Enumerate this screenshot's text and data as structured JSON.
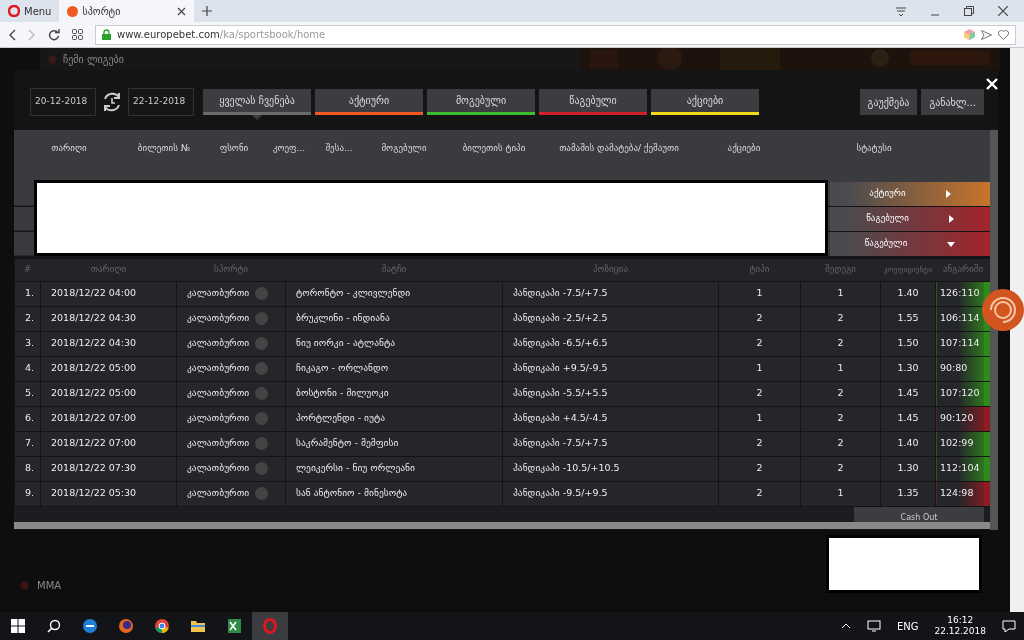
{
  "browser": {
    "menu_label": "Menu",
    "tabs": [
      {
        "label": "სპორტი",
        "selected": true
      }
    ],
    "url": {
      "domain": "www.europebet.com",
      "path": "/ka/sportsbook/home"
    }
  },
  "background": {
    "my_leagues": "ჩემი ლიგები",
    "sidebar": [
      "MMA"
    ],
    "cashout": "Cash Out"
  },
  "modal": {
    "date_from": "20-12-2018",
    "date_to": "22-12-2018",
    "filters": [
      {
        "label": "ყველას ჩვენება",
        "color": "#6b6c70",
        "selected": true
      },
      {
        "label": "აქტიური",
        "color": "#f05a22",
        "selected": false
      },
      {
        "label": "მოგებული",
        "color": "#3dbb2c",
        "selected": false
      },
      {
        "label": "წაგებული",
        "color": "#d0202a",
        "selected": false
      },
      {
        "label": "აქციები",
        "color": "#f2dc14",
        "selected": false
      }
    ],
    "actions": [
      "გაუქმება",
      "განახლ..."
    ],
    "columns": [
      "თარიღი",
      "ბილეთის №",
      "ფსონი",
      "კოეფ...",
      "შესა...",
      "მოგებული",
      "ბილეთის ტიპი",
      "თამაშის დამატება/ ქეშაუთი",
      "აქციები",
      "სტატუსი"
    ],
    "groups": [
      {
        "status": "აქტიური",
        "color": "#c8742c",
        "expanded": false
      },
      {
        "status": "წაგებული",
        "color": "#a3242c",
        "expanded": false
      },
      {
        "status": "წაგებული",
        "color": "#a3242c",
        "expanded": true
      }
    ],
    "table": {
      "columns": [
        "#",
        "თარიღი",
        "სპორტი",
        "მატჩი",
        "პოზიცია",
        "ტიპი",
        "შედეგი",
        "კოეფიციენტი",
        "ანგარიში"
      ],
      "rows": [
        {
          "num": "1.",
          "date": "2018/12/22 04:00",
          "sport": "კალათბურთი",
          "match": "ტორონტო - კლივლენდი",
          "position": "ჰანდიკაპი -7.5/+7.5",
          "type": "1",
          "result": "1",
          "coef": "1.40",
          "score": "126:110",
          "color": "#2f8a1c"
        },
        {
          "num": "2.",
          "date": "2018/12/22 04:30",
          "sport": "კალათბურთი",
          "match": "ბრუკლინი - ინდიანა",
          "position": "ჰანდიკაპი -2.5/+2.5",
          "type": "2",
          "result": "2",
          "coef": "1.55",
          "score": "106:114",
          "color": "#2f8a1c"
        },
        {
          "num": "3.",
          "date": "2018/12/22 04:30",
          "sport": "კალათბურთი",
          "match": "ნიუ იორკი - ატლანტა",
          "position": "ჰანდიკაპი -6.5/+6.5",
          "type": "2",
          "result": "2",
          "coef": "1.50",
          "score": "107:114",
          "color": "#2f8a1c"
        },
        {
          "num": "4.",
          "date": "2018/12/22 05:00",
          "sport": "კალათბურთი",
          "match": "ჩიკაგო - ორლანდო",
          "position": "ჰანდიკაპი +9.5/-9.5",
          "type": "1",
          "result": "1",
          "coef": "1.30",
          "score": "90:80",
          "color": "#2f8a1c"
        },
        {
          "num": "5.",
          "date": "2018/12/22 05:00",
          "sport": "კალათბურთი",
          "match": "ბოსტონი - მილუოკი",
          "position": "ჰანდიკაპი -5.5/+5.5",
          "type": "2",
          "result": "2",
          "coef": "1.45",
          "score": "107:120",
          "color": "#2f8a1c"
        },
        {
          "num": "6.",
          "date": "2018/12/22 07:00",
          "sport": "კალათბურთი",
          "match": "პორტლენდი - იუტა",
          "position": "ჰანდიკაპი +4.5/-4.5",
          "type": "1",
          "result": "2",
          "coef": "1.45",
          "score": "90:120",
          "color": "#8e1c22"
        },
        {
          "num": "7.",
          "date": "2018/12/22 07:00",
          "sport": "კალათბურთი",
          "match": "საკრამენტო - მემფისი",
          "position": "ჰანდიკაპი -7.5/+7.5",
          "type": "2",
          "result": "2",
          "coef": "1.40",
          "score": "102:99",
          "color": "#2f8a1c"
        },
        {
          "num": "8.",
          "date": "2018/12/22 07:30",
          "sport": "კალათბურთი",
          "match": "ლეიკერსი - ნიუ ორლეანი",
          "position": "ჰანდიკაპი -10.5/+10.5",
          "type": "2",
          "result": "2",
          "coef": "1.30",
          "score": "112:104",
          "color": "#2f8a1c"
        },
        {
          "num": "9.",
          "date": "2018/12/22 05:30",
          "sport": "კალათბურთი",
          "match": "სან ანტონიო - მინესოტა",
          "position": "ჰანდიკაპი -9.5/+9.5",
          "type": "2",
          "result": "1",
          "coef": "1.35",
          "score": "124:98",
          "color": "#8e1c22"
        }
      ]
    }
  },
  "taskbar": {
    "lang": "ENG",
    "time": "16:12",
    "date": "22.12.2018"
  }
}
